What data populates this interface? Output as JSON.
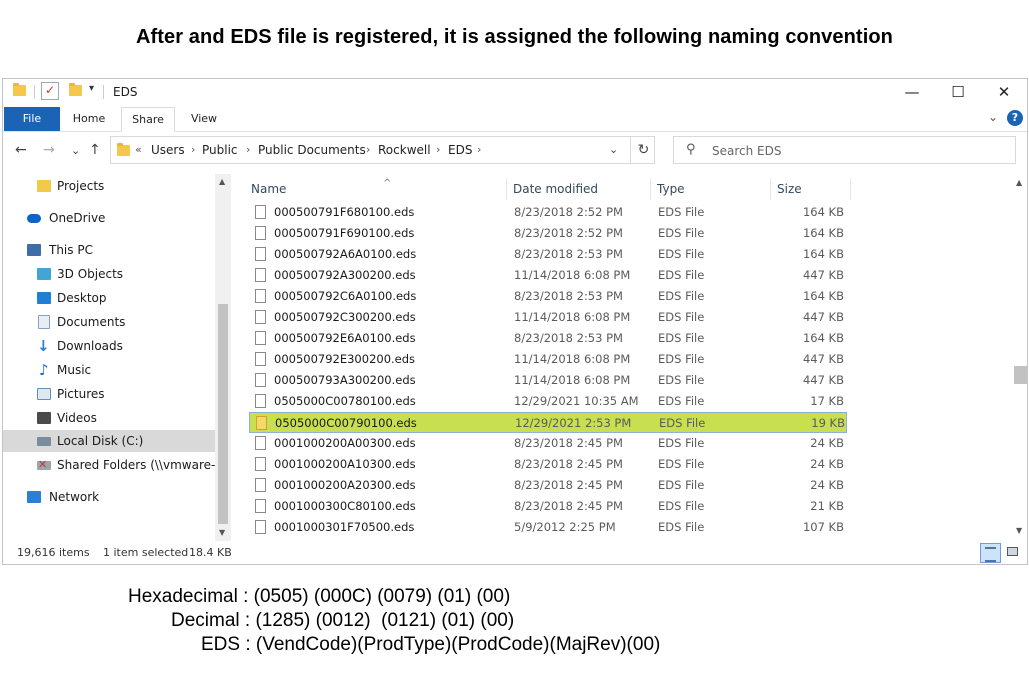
{
  "heading": "After and EDS file is registered, it is assigned the following naming convention",
  "window": {
    "title": "EDS",
    "controls": {
      "minimize": "—",
      "maximize": "☐",
      "close": "✕"
    },
    "ribbon": {
      "tabs": [
        "File",
        "Home",
        "Share",
        "View"
      ],
      "chevron": "⌄",
      "help": "?"
    },
    "nav": {
      "back": "←",
      "forward": "→",
      "recent": "⌄",
      "up": "↑"
    },
    "address": {
      "overflow": "«",
      "crumbs": [
        "Users",
        "Public",
        "Public Documents",
        "Rockwell",
        "EDS"
      ],
      "sep": "›",
      "drop": "⌄",
      "refresh": "↻"
    },
    "search": {
      "placeholder": "Search EDS",
      "value": ""
    },
    "sidebar": [
      {
        "label": "Projects",
        "icon": "folder-icon",
        "color": "#f4c94b"
      },
      {
        "label": "OneDrive",
        "icon": "onedrive-cloud-icon",
        "color": "#0a64c9"
      },
      {
        "label": "This PC",
        "icon": "computer-icon",
        "color": "#3c6ea8"
      },
      {
        "label": "3D Objects",
        "icon": "cube-icon",
        "color": "#41a6d6"
      },
      {
        "label": "Desktop",
        "icon": "desktop-icon",
        "color": "#1e7fd4"
      },
      {
        "label": "Documents",
        "icon": "documents-icon",
        "color": "#8aa3bd"
      },
      {
        "label": "Downloads",
        "icon": "download-arrow-icon",
        "color": "#2c7fd6"
      },
      {
        "label": "Music",
        "icon": "music-note-icon",
        "color": "#1d6ed0"
      },
      {
        "label": "Pictures",
        "icon": "pictures-icon",
        "color": "#6a8fb5"
      },
      {
        "label": "Videos",
        "icon": "film-icon",
        "color": "#4a4a4a"
      },
      {
        "label": "Local Disk (C:)",
        "icon": "drive-icon",
        "color": "#7a8d9e"
      },
      {
        "label": "Shared Folders (\\\\vmware-ho",
        "icon": "network-drive-icon",
        "color": "#c0392b"
      },
      {
        "label": "Network",
        "icon": "network-icon",
        "color": "#2c7fd6"
      }
    ],
    "columns": {
      "name": "Name",
      "date": "Date modified",
      "type": "Type",
      "size": "Size"
    },
    "files": [
      {
        "name": "000500791F680100.eds",
        "date": "8/23/2018 2:52 PM",
        "type": "EDS File",
        "size": "164 KB"
      },
      {
        "name": "000500791F690100.eds",
        "date": "8/23/2018 2:52 PM",
        "type": "EDS File",
        "size": "164 KB"
      },
      {
        "name": "000500792A6A0100.eds",
        "date": "8/23/2018 2:53 PM",
        "type": "EDS File",
        "size": "164 KB"
      },
      {
        "name": "000500792A300200.eds",
        "date": "11/14/2018 6:08 PM",
        "type": "EDS File",
        "size": "447 KB"
      },
      {
        "name": "000500792C6A0100.eds",
        "date": "8/23/2018 2:53 PM",
        "type": "EDS File",
        "size": "164 KB"
      },
      {
        "name": "000500792C300200.eds",
        "date": "11/14/2018 6:08 PM",
        "type": "EDS File",
        "size": "447 KB"
      },
      {
        "name": "000500792E6A0100.eds",
        "date": "8/23/2018 2:53 PM",
        "type": "EDS File",
        "size": "164 KB"
      },
      {
        "name": "000500792E300200.eds",
        "date": "11/14/2018 6:08 PM",
        "type": "EDS File",
        "size": "447 KB"
      },
      {
        "name": "000500793A300200.eds",
        "date": "11/14/2018 6:08 PM",
        "type": "EDS File",
        "size": "447 KB"
      },
      {
        "name": "0505000C00780100.eds",
        "date": "12/29/2021 10:35 AM",
        "type": "EDS File",
        "size": "17 KB"
      },
      {
        "name": "0505000C00790100.eds",
        "date": "12/29/2021 2:53 PM",
        "type": "EDS File",
        "size": "19 KB",
        "selected": true
      },
      {
        "name": "0001000200A00300.eds",
        "date": "8/23/2018 2:45 PM",
        "type": "EDS File",
        "size": "24 KB"
      },
      {
        "name": "0001000200A10300.eds",
        "date": "8/23/2018 2:45 PM",
        "type": "EDS File",
        "size": "24 KB"
      },
      {
        "name": "0001000200A20300.eds",
        "date": "8/23/2018 2:45 PM",
        "type": "EDS File",
        "size": "24 KB"
      },
      {
        "name": "0001000300C80100.eds",
        "date": "8/23/2018 2:45 PM",
        "type": "EDS File",
        "size": "21 KB"
      },
      {
        "name": "0001000301F70500.eds",
        "date": "5/9/2012 2:25 PM",
        "type": "EDS File",
        "size": "107 KB"
      }
    ],
    "status": {
      "items": "19,616 items",
      "selected": "1 item selected",
      "size": "18.4 KB"
    },
    "selection_color": "#c8df4f"
  },
  "formula": {
    "hex": "Hexadecimal : (0505) (000C) (0079) (01) (00)",
    "dec": "Decimal : (1285) (0012)  (0121) (01) (00)",
    "eds": "EDS : (VendCode)(ProdType)(ProdCode)(MajRev)(00)"
  }
}
